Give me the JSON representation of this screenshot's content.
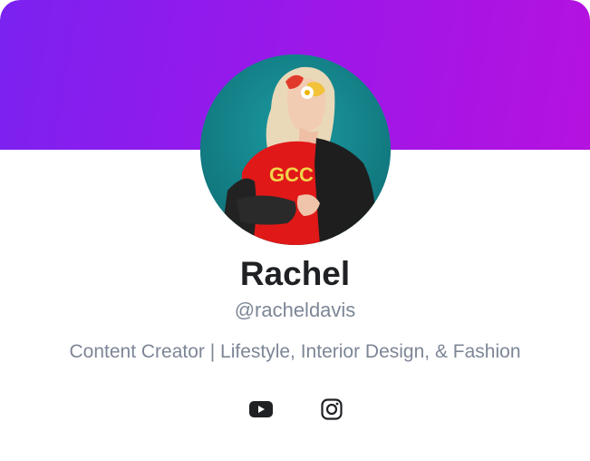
{
  "profile": {
    "name": "Rachel",
    "handle": "@racheldavis",
    "bio": "Content Creator | Lifestyle, Interior Design, & Fashion",
    "avatar": "profile photo"
  },
  "socials": [
    {
      "icon": "youtube-icon"
    },
    {
      "icon": "instagram-icon"
    }
  ],
  "colors": {
    "banner_start": "#7b22f0",
    "banner_end": "#b512df",
    "name": "#1f2124",
    "muted_text": "#7d8696",
    "icon": "#1f2124"
  }
}
